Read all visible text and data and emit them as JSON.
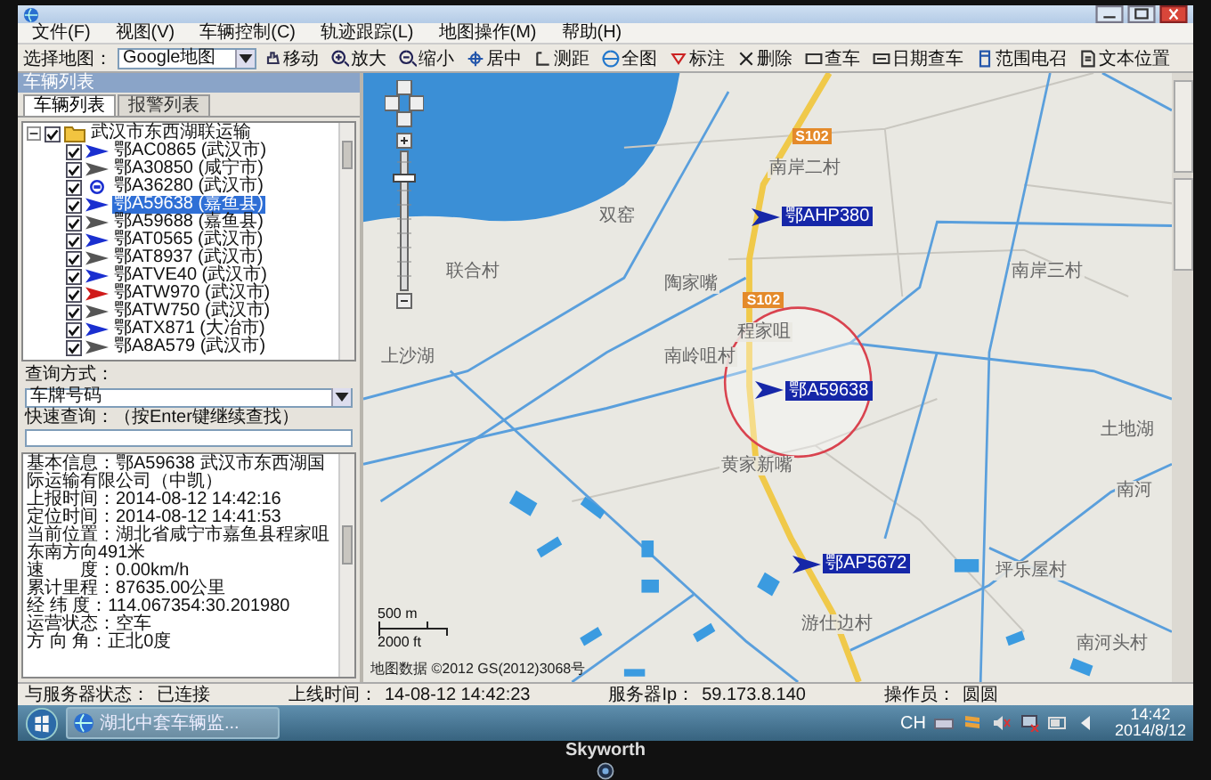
{
  "menu": [
    {
      "label": "文件(F)"
    },
    {
      "label": "视图(V)"
    },
    {
      "label": "车辆控制(C)"
    },
    {
      "label": "轨迹跟踪(L)"
    },
    {
      "label": "地图操作(M)"
    },
    {
      "label": "帮助(H)"
    }
  ],
  "toolbar": {
    "map_select_label": "选择地图：",
    "map_select_value": "Google地图",
    "buttons": [
      "移动",
      "放大",
      "缩小",
      "居中",
      "测距",
      "全图",
      "标注",
      "删除",
      "查车",
      "日期查车",
      "范围电召",
      "文本位置"
    ]
  },
  "panel": {
    "title": "车辆列表",
    "tabs": [
      {
        "label": "车辆列表",
        "selected": true
      },
      {
        "label": "报警列表",
        "selected": false
      }
    ],
    "tree": {
      "label": "武汉市东西湖联运输",
      "checked": true,
      "expanded": true,
      "children": [
        {
          "label": "鄂AC0865 (武汉市)",
          "checked": true,
          "selected": false,
          "kind": "arrow",
          "color": "#1a2fd0"
        },
        {
          "label": "鄂A30850 (咸宁市)",
          "checked": true,
          "selected": false,
          "kind": "arrow",
          "color": "#555555"
        },
        {
          "label": "鄂A36280 (武汉市)",
          "checked": true,
          "selected": false,
          "kind": "circle",
          "color": "#1a2fd0"
        },
        {
          "label": "鄂A59638 (嘉鱼县)",
          "checked": true,
          "selected": true,
          "kind": "arrow",
          "color": "#1a2fd0"
        },
        {
          "label": "鄂A59688 (嘉鱼县)",
          "checked": true,
          "selected": false,
          "kind": "arrow",
          "color": "#555555"
        },
        {
          "label": "鄂AT0565 (武汉市)",
          "checked": true,
          "selected": false,
          "kind": "arrow",
          "color": "#1a2fd0"
        },
        {
          "label": "鄂AT8937 (武汉市)",
          "checked": true,
          "selected": false,
          "kind": "arrow",
          "color": "#555555"
        },
        {
          "label": "鄂ATVE40 (武汉市)",
          "checked": true,
          "selected": false,
          "kind": "arrow",
          "color": "#1a2fd0"
        },
        {
          "label": "鄂ATW970 (武汉市)",
          "checked": true,
          "selected": false,
          "kind": "arrow",
          "color": "#d01a1a"
        },
        {
          "label": "鄂ATW750 (武汉市)",
          "checked": true,
          "selected": false,
          "kind": "arrow",
          "color": "#555555"
        },
        {
          "label": "鄂ATX871 (大冶市)",
          "checked": true,
          "selected": false,
          "kind": "arrow",
          "color": "#1a2fd0"
        },
        {
          "label": "鄂A8A579 (武汉市)",
          "checked": true,
          "selected": false,
          "kind": "arrow",
          "color": "#555555"
        }
      ]
    },
    "query": {
      "mode_label": "查询方式：",
      "mode_value": "车牌号码",
      "quick_label": "快速查询：（按Enter键继续查找）"
    },
    "info": [
      {
        "label": "基本信息：",
        "value": "鄂A59638  武汉市东西湖国际运输有限公司（中凯）"
      },
      {
        "label": "上报时间：",
        "value": "2014-08-12 14:42:16"
      },
      {
        "label": "定位时间：",
        "value": "2014-08-12 14:41:53"
      },
      {
        "label": "当前位置：",
        "value": "湖北省咸宁市嘉鱼县程家咀东南方向491米"
      },
      {
        "label": "速　　度：",
        "value": "0.00km/h"
      },
      {
        "label": "累计里程：",
        "value": "87635.00公里"
      },
      {
        "label": "经 纬 度：",
        "value": "114.067354:30.201980"
      },
      {
        "label": "运营状态：",
        "value": "空车"
      },
      {
        "label": "方 向 角：",
        "value": "正北0度"
      }
    ]
  },
  "map": {
    "places": [
      "南岸二村",
      "双窑",
      "联合村",
      "陶家嘴",
      "南岸三村",
      "程家咀",
      "南岭咀村",
      "上沙湖",
      "黄家新嘴",
      "土地湖",
      "南河",
      "坪乐屋村",
      "游仕边村",
      "南河头村"
    ],
    "road_badges": [
      "S102",
      "S102"
    ],
    "vehicles": [
      {
        "label": "鄂AHP380"
      },
      {
        "label": "鄂A59638"
      },
      {
        "label": "鄂AP5672"
      }
    ],
    "scale": {
      "metric": "500 m",
      "imperial": "2000 ft"
    },
    "copyright": "地图数据 ©2012 GS(2012)3068号"
  },
  "status_bar": [
    {
      "label": "与服务器状态：",
      "value": "已连接"
    },
    {
      "label": "上线时间：",
      "value": "14-08-12 14:42:23"
    },
    {
      "label": "服务器Ip：",
      "value": "59.173.8.140"
    },
    {
      "label": "操作员：",
      "value": "圆圆"
    }
  ],
  "taskbar": {
    "task": "湖北中套车辆监...",
    "language": "CH",
    "time": "14:42",
    "date": "2014/8/12"
  },
  "brand": "Skyworth"
}
